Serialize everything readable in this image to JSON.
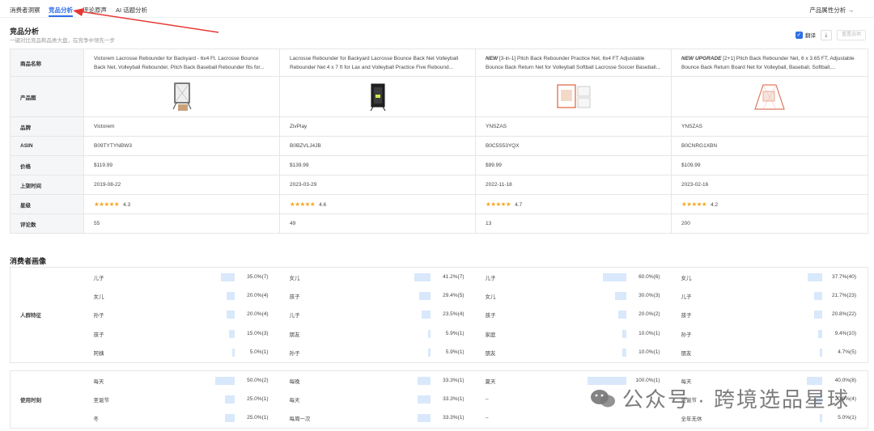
{
  "nav": {
    "tabs": [
      "消费者洞察",
      "竞品分析",
      "评论原声",
      "AI 话题分析"
    ],
    "right_link": "产品属性分析 →"
  },
  "header": {
    "title": "竞品分析",
    "subtitle": "一键对比竞品和品类大盘，在竞争中领先一步",
    "translate_label": "翻译",
    "download_icon": "⤓",
    "reset_label": "重置选项"
  },
  "colors": {
    "accent": "#2f6ee6",
    "bar": "#d9e8fb",
    "star": "#f5a623",
    "arrow": "#e53935"
  },
  "compare": {
    "labels": {
      "name": "商品名称",
      "image": "产品图",
      "brand": "品牌",
      "asin": "ASIN",
      "price": "价格",
      "date": "上架时间",
      "rating": "星级",
      "reviews": "评论数"
    },
    "products": [
      {
        "name": "Victorem Lacrosse Rebounder for Backyard - 6x4 Ft. Lacrosse Bounce Back Net, Volleyball Rebounder, Pitch Back Baseball Rebounder fits for...",
        "brand": "Victorem",
        "asin": "B09TYTYNBW3",
        "price": "$119.99",
        "date": "2019-08-22",
        "stars": "★★★★★",
        "rating": "4.3",
        "reviews": "55"
      },
      {
        "name": "Lacrosse Rebounder for Backyard Lacrosse Bounce Back Net Volleyball Rebounder Net 4 x 7 ft for Lax and Volleyball Practice Five Rebound...",
        "brand": "ZivPlay",
        "asin": "B0BZVLJ4JB",
        "price": "$139.99",
        "date": "2023-03-29",
        "stars": "★★★★★",
        "rating": "4.6",
        "reviews": "49"
      },
      {
        "name_prefix": "NEW",
        "name": " [3-in-1] Pitch Back Rebounder Practice Net, 6x4 FT Adjustable Bounce Back Return Net for Volleyball Softball Lacrosse Soccer Baseball...",
        "brand": "YNSZAS",
        "asin": "B0C5S53YQX",
        "price": "$99.99",
        "date": "2022-11-18",
        "stars": "★★★★★",
        "rating": "4.7",
        "reviews": "13"
      },
      {
        "name_prefix": "NEW UPGRADE",
        "name": " [2+1] Pitch Back Rebounder Net, 6 x 3.65 FT, Adjustable Bounce Back Return Board Net for Volleyball, Baseball, Softball,...",
        "brand": "YNSZAS",
        "asin": "B0CNRG1XBN",
        "price": "$109.99",
        "date": "2023-02-16",
        "stars": "★★★★★",
        "rating": "4.2",
        "reviews": "200"
      }
    ]
  },
  "consumer": {
    "title": "消费者画像",
    "groups": [
      {
        "label": "人群特征",
        "rows": [
          [
            [
              "儿子",
              "35.0%(7)",
              0.35
            ],
            [
              "女儿",
              "41.2%(7)",
              0.412
            ],
            [
              "儿子",
              "60.0%(6)",
              0.6
            ],
            [
              "女儿",
              "37.7%(40)",
              0.377
            ]
          ],
          [
            [
              "女儿",
              "20.0%(4)",
              0.2
            ],
            [
              "孩子",
              "29.4%(5)",
              0.294
            ],
            [
              "女儿",
              "30.0%(3)",
              0.3
            ],
            [
              "儿子",
              "21.7%(23)",
              0.217
            ]
          ],
          [
            [
              "孙子",
              "20.0%(4)",
              0.2
            ],
            [
              "儿子",
              "23.5%(4)",
              0.235
            ],
            [
              "孩子",
              "20.0%(2)",
              0.2
            ],
            [
              "孩子",
              "20.8%(22)",
              0.208
            ]
          ],
          [
            [
              "孩子",
              "15.0%(3)",
              0.15
            ],
            [
              "朋友",
              "5.9%(1)",
              0.059
            ],
            [
              "家庭",
              "10.0%(1)",
              0.1
            ],
            [
              "孙子",
              "9.4%(10)",
              0.094
            ]
          ],
          [
            [
              "阿姨",
              "5.0%(1)",
              0.05
            ],
            [
              "孙子",
              "5.9%(1)",
              0.059
            ],
            [
              "朋友",
              "10.0%(1)",
              0.1
            ],
            [
              "朋友",
              "4.7%(5)",
              0.047
            ]
          ]
        ]
      },
      {
        "label": "使用时刻",
        "rows": [
          [
            [
              "每天",
              "50.0%(2)",
              0.5
            ],
            [
              "每晚",
              "33.3%(1)",
              0.333
            ],
            [
              "夏天",
              "100.0%(1)",
              1.0
            ],
            [
              "每天",
              "40.0%(8)",
              0.4
            ]
          ],
          [
            [
              "圣诞节",
              "25.0%(1)",
              0.25
            ],
            [
              "每天",
              "33.3%(1)",
              0.333
            ],
            [
              "--",
              "",
              0
            ],
            [
              "圣诞节",
              "20.0%(4)",
              0.2
            ]
          ],
          [
            [
              "冬",
              "25.0%(1)",
              0.25
            ],
            [
              "每周一次",
              "33.3%(1)",
              0.333
            ],
            [
              "--",
              "",
              0
            ],
            [
              "全年无休",
              "5.0%(1)",
              0.05
            ]
          ]
        ]
      }
    ]
  },
  "watermark": {
    "text": "公众号 · 跨境选品星球"
  }
}
